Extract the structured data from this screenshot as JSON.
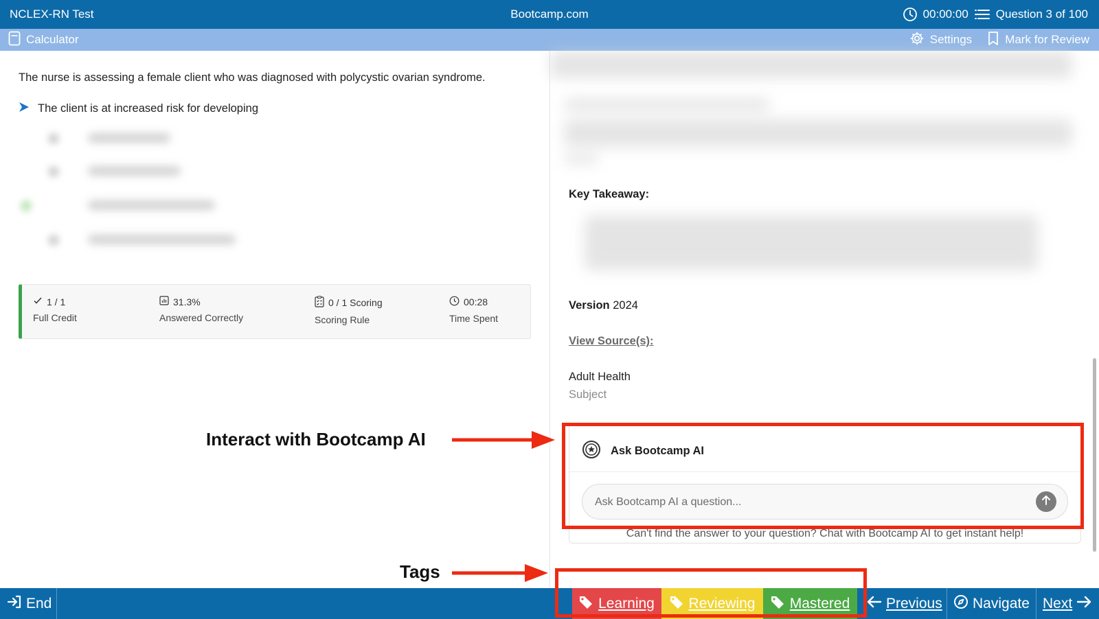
{
  "header": {
    "app_title": "NCLEX-RN Test",
    "site": "Bootcamp.com",
    "timer": "00:00:00",
    "question_counter": "Question 3 of 100"
  },
  "toolbar": {
    "calculator": "Calculator",
    "settings": "Settings",
    "mark_review": "Mark for Review"
  },
  "question": {
    "text": "The nurse is assessing a female client who was diagnosed with polycystic ovarian syndrome.",
    "stem": "The client is at increased risk for developing"
  },
  "stats": {
    "credit_value": "1 / 1",
    "credit_label": "Full Credit",
    "percent_value": "31.3%",
    "percent_label": "Answered Correctly",
    "scoring_value": "0 / 1 Scoring",
    "scoring_label": "Scoring Rule",
    "time_value": "00:28",
    "time_label": "Time Spent"
  },
  "explanation": {
    "key_takeaway": "Key Takeaway:",
    "version_label": "Version",
    "version_value": "2024",
    "view_sources": "View Source(s):",
    "subject_value": "Adult Health",
    "subject_label": "Subject"
  },
  "ai": {
    "title": "Ask Bootcamp AI",
    "placeholder": "Ask Bootcamp AI a question...",
    "help": "Can't find the answer to your question? Chat with Bootcamp AI to get instant help!"
  },
  "annotations": {
    "ai_label": "Interact with Bootcamp AI",
    "tags_label": "Tags",
    "color": "#ec2b12"
  },
  "footer": {
    "end": "End",
    "tags": [
      {
        "label": "Learning",
        "color": "#e4474a"
      },
      {
        "label": "Reviewing",
        "color": "#f2d431"
      },
      {
        "label": "Mastered",
        "color": "#4caa45"
      }
    ],
    "previous": "Previous",
    "navigate": "Navigate",
    "next": "Next"
  },
  "colors": {
    "primary": "#0d6aa8",
    "subbar": "#8fb6e6",
    "credit_green": "#3aa34a"
  }
}
